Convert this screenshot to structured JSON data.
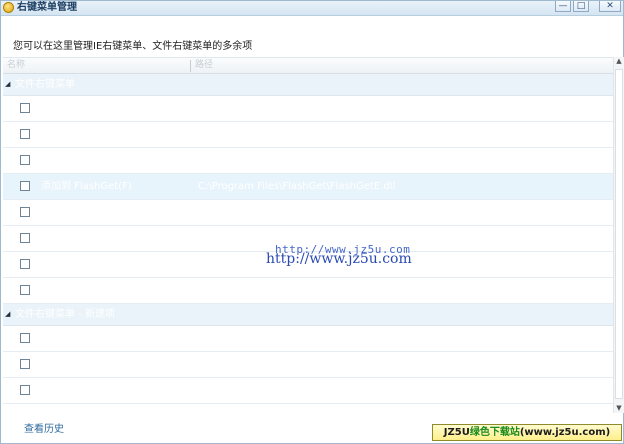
{
  "window": {
    "title": "右键菜单管理",
    "buttons": {
      "minimize": "—",
      "maximize": "□",
      "close": "✕"
    }
  },
  "description": "您可以在这里管理IE右键菜单、文件右键菜单的多余项",
  "table": {
    "columns": [
      "名称",
      "路径"
    ],
    "groups": [
      {
        "label": "文件右键菜单",
        "rows": [
          {
            "name": "",
            "path": "",
            "selected": false
          },
          {
            "name": "",
            "path": "",
            "selected": false
          },
          {
            "name": "",
            "path": "",
            "selected": false
          },
          {
            "name": "添加到 FlashGet(F)",
            "path": "C:\\Program Files\\FlashGet\\FlashGetE.dll",
            "selected": true
          },
          {
            "name": "",
            "path": "",
            "selected": false
          },
          {
            "name": "",
            "path": "",
            "selected": false
          },
          {
            "name": "",
            "path": "",
            "selected": false
          },
          {
            "name": "",
            "path": "",
            "selected": false
          }
        ]
      },
      {
        "label": "文件右键菜单 - 新建项",
        "rows": [
          {
            "name": "",
            "path": "",
            "selected": false
          },
          {
            "name": "",
            "path": "",
            "selected": false
          },
          {
            "name": "",
            "path": "",
            "selected": false
          }
        ]
      }
    ]
  },
  "footer": {
    "history_link": "查看历史"
  },
  "watermark": {
    "url_small": "http://www.jz5u.com",
    "url_large": "http://www.jz5u.com",
    "badge_prefix": "JZ5U",
    "badge_mid": "绿色下载站",
    "badge_suffix": "(www.jz5u.com)"
  }
}
